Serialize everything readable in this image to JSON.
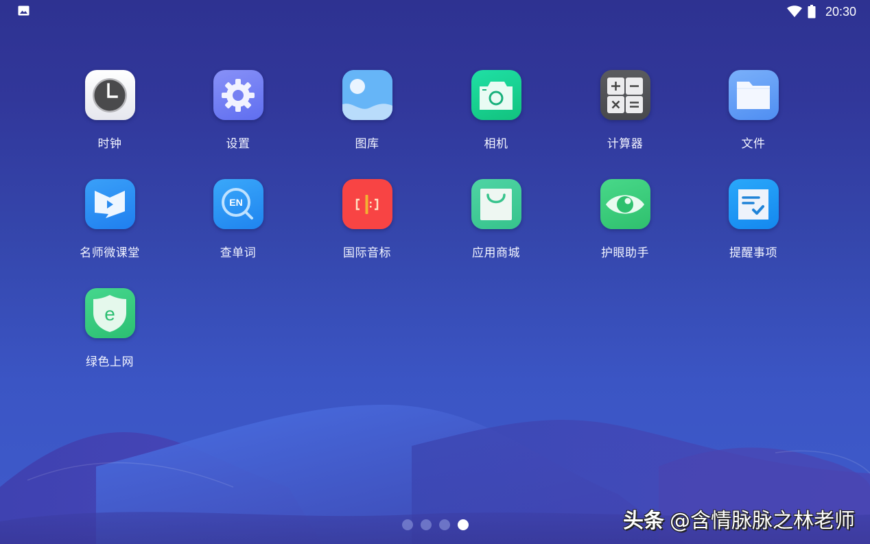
{
  "status_bar": {
    "left_icon": "image-notification-icon",
    "wifi_icon": "wifi-icon",
    "battery_icon": "battery-icon",
    "time": "20:30"
  },
  "apps": [
    {
      "label": "时钟",
      "icon": "clock-icon",
      "color": "#f2f2f6"
    },
    {
      "label": "设置",
      "icon": "gear-icon",
      "color": "#6f7cf0"
    },
    {
      "label": "图库",
      "icon": "gallery-icon",
      "color": "#6ab4f5"
    },
    {
      "label": "相机",
      "icon": "camera-icon",
      "color": "#1fd69a"
    },
    {
      "label": "计算器",
      "icon": "calculator-icon",
      "color": "#545559"
    },
    {
      "label": "文件",
      "icon": "folder-icon",
      "color": "#5d9cf5"
    },
    {
      "label": "名师微课堂",
      "icon": "video-book-icon",
      "color": "#2f8cf2"
    },
    {
      "label": "查单词",
      "icon": "dictionary-search-icon",
      "color": "#2b93f3"
    },
    {
      "label": "国际音标",
      "icon": "phonetic-icon",
      "color": "#f84545"
    },
    {
      "label": "应用商城",
      "icon": "shopping-bag-icon",
      "color": "#3ec99a"
    },
    {
      "label": "护眼助手",
      "icon": "eye-icon",
      "color": "#35c97a"
    },
    {
      "label": "提醒事项",
      "icon": "reminder-checklist-icon",
      "color": "#1e9df5"
    },
    {
      "label": "绿色上网",
      "icon": "shield-e-icon",
      "color": "#35c97a"
    }
  ],
  "page_indicator": {
    "total": 4,
    "current": 4
  },
  "watermark": {
    "brand": "头条",
    "handle": "@含情脉脉之林老师"
  }
}
